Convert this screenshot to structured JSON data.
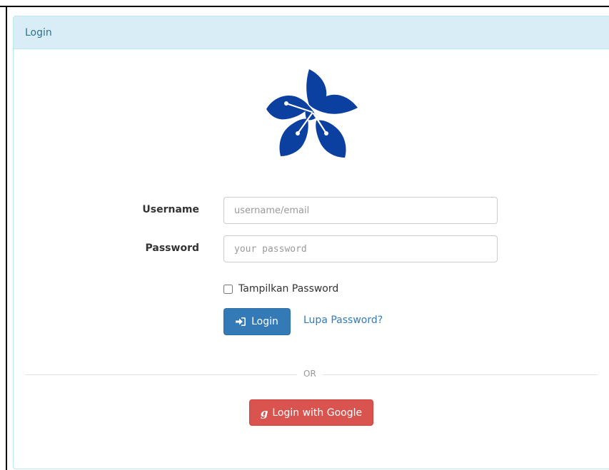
{
  "panel": {
    "title": "Login"
  },
  "form": {
    "username_label": "Username",
    "username_placeholder": "username/email",
    "password_label": "Password",
    "password_placeholder": "your password",
    "show_password_label": "Tampilkan Password",
    "login_button_label": "Login",
    "forgot_password_label": "Lupa Password?"
  },
  "divider": {
    "text": "OR"
  },
  "google": {
    "button_label": "Login with Google",
    "icon_glyph": "g"
  },
  "icons": {
    "logo": "flower-logo-icon",
    "login": "sign-in-icon",
    "google": "google-icon"
  },
  "colors": {
    "heading_bg": "#d9edf7",
    "heading_text": "#31708f",
    "logo_blue": "#0b3fa0",
    "primary": "#337ab7",
    "danger": "#d9534f"
  }
}
